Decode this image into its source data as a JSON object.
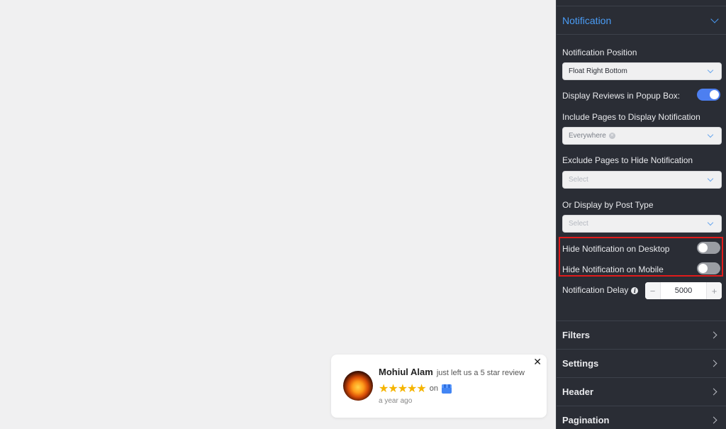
{
  "panel": {
    "section": {
      "title": "Notification",
      "expanded": true
    },
    "fields": {
      "position": {
        "label": "Notification Position",
        "value": "Float Right Bottom"
      },
      "display_popup": {
        "label": "Display Reviews in Popup Box:",
        "enabled": true
      },
      "include_pages": {
        "label": "Include Pages to Display Notification",
        "chip": "Everywhere"
      },
      "exclude_pages": {
        "label": "Exclude Pages to Hide Notification",
        "placeholder": "Select"
      },
      "post_type": {
        "label": "Or Display by Post Type",
        "placeholder": "Select"
      },
      "hide_desktop": {
        "label": "Hide Notification on Desktop",
        "enabled": false
      },
      "hide_mobile": {
        "label": "Hide Notification on Mobile",
        "enabled": false
      },
      "delay": {
        "label": "Notification Delay",
        "value": "5000",
        "minus": "−",
        "plus": "+"
      }
    },
    "accordions": [
      {
        "label": "Filters"
      },
      {
        "label": "Settings"
      },
      {
        "label": "Header"
      },
      {
        "label": "Pagination"
      }
    ]
  },
  "popup": {
    "name": "Mohiul Alam",
    "message": "just left us a 5 star review",
    "rating": 5,
    "stars": "★★★★★",
    "on_text": "on",
    "time": "a year ago",
    "close": "✕",
    "source_icon": "google-business-icon"
  },
  "colors": {
    "accent": "#4a9cf5",
    "panel_bg": "#2a2d35",
    "highlight": "#e01b1b",
    "star": "#f5b400"
  }
}
